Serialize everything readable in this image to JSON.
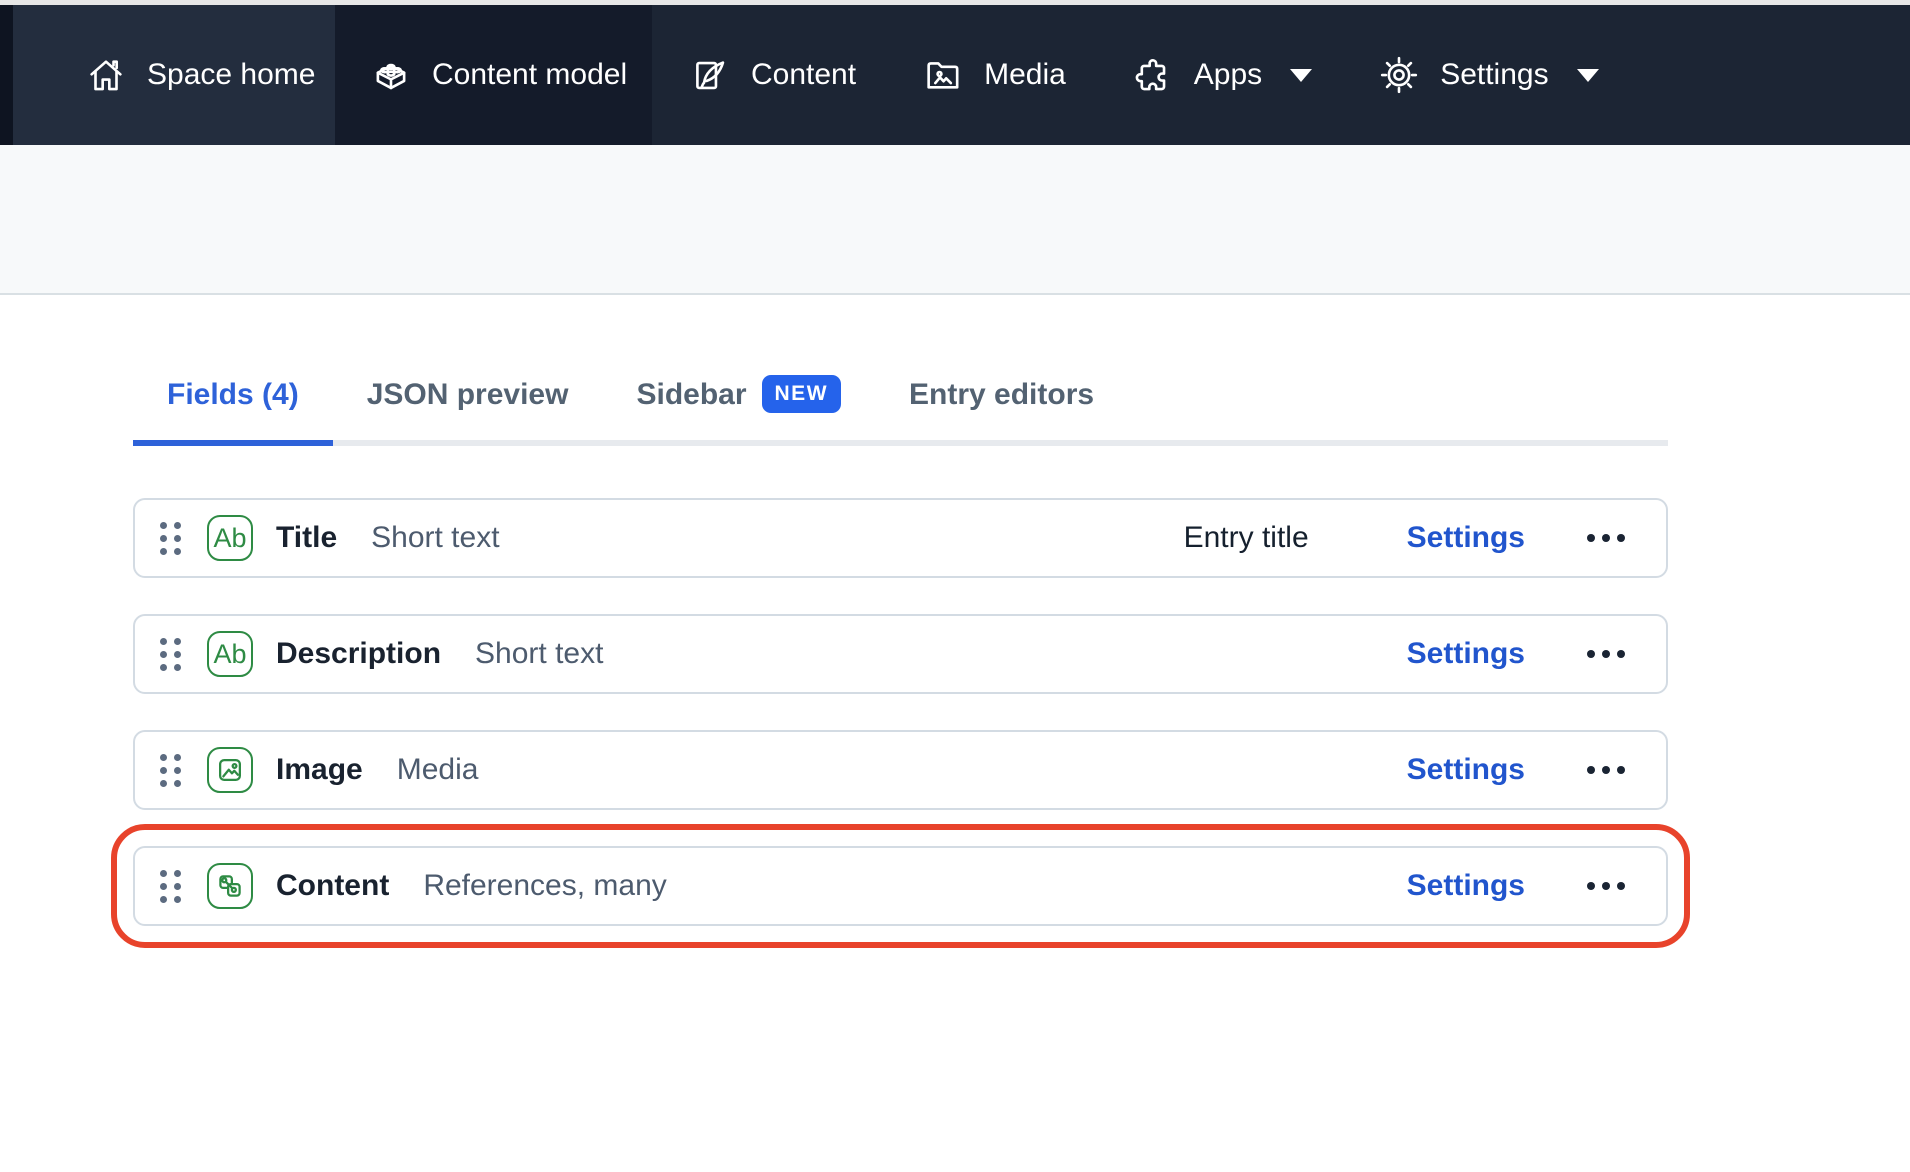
{
  "nav": {
    "space_home": "Space home",
    "content_model": "Content model",
    "content": "Content",
    "media": "Media",
    "apps": "Apps",
    "settings": "Settings"
  },
  "tabs": {
    "fields": "Fields (4)",
    "json_preview": "JSON preview",
    "sidebar": "Sidebar",
    "sidebar_badge": "NEW",
    "entry_editors": "Entry editors"
  },
  "icons": {
    "text_glyph": "Ab"
  },
  "fields": [
    {
      "name": "Title",
      "type": "Short text",
      "icon": "text",
      "entry_title": "Entry title",
      "settings": "Settings",
      "highlighted": false
    },
    {
      "name": "Description",
      "type": "Short text",
      "icon": "text",
      "entry_title": "",
      "settings": "Settings",
      "highlighted": false
    },
    {
      "name": "Image",
      "type": "Media",
      "icon": "media",
      "entry_title": "",
      "settings": "Settings",
      "highlighted": false
    },
    {
      "name": "Content",
      "type": "References, many",
      "icon": "reference",
      "entry_title": "",
      "settings": "Settings",
      "highlighted": true
    }
  ],
  "colors": {
    "green": "#2e8b44",
    "blue_link": "#2155cd",
    "tab_blue": "#2e62d9",
    "badge_blue": "#2563eb",
    "highlight_red": "#e8432b"
  }
}
